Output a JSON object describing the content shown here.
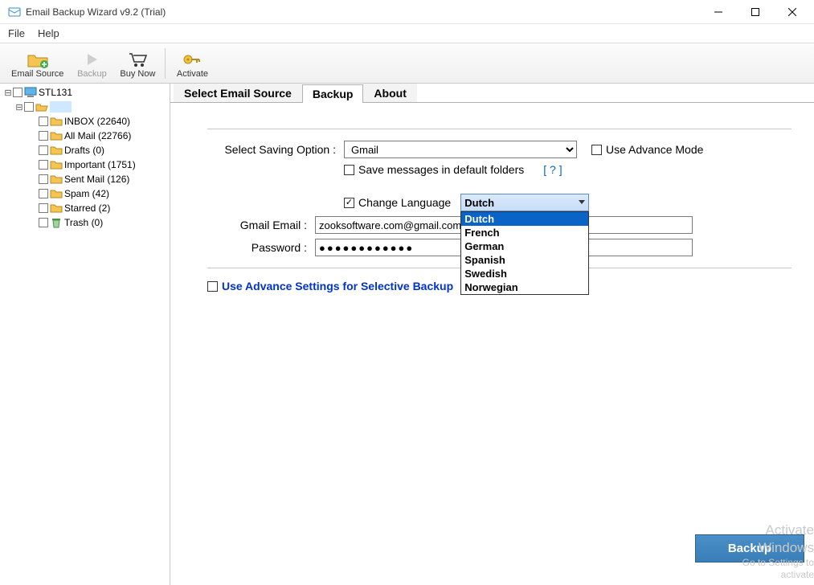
{
  "window": {
    "title": "Email Backup Wizard v9.2 (Trial)"
  },
  "menubar": {
    "file": "File",
    "help": "Help"
  },
  "toolbar": {
    "email_source": "Email Source",
    "backup": "Backup",
    "buy_now": "Buy Now",
    "activate": "Activate"
  },
  "sidebar": {
    "root": "STL131",
    "folders": [
      {
        "name": "INBOX (22640)"
      },
      {
        "name": "All Mail (22766)"
      },
      {
        "name": "Drafts (0)"
      },
      {
        "name": "Important (1751)"
      },
      {
        "name": "Sent Mail (126)"
      },
      {
        "name": "Spam (42)"
      },
      {
        "name": "Starred (2)"
      },
      {
        "name": "Trash (0)"
      }
    ]
  },
  "tabs": {
    "select_source": "Select Email Source",
    "backup": "Backup",
    "about": "About"
  },
  "panel": {
    "saving_option_label": "Select Saving Option :",
    "saving_option_value": "Gmail",
    "advance_mode_label": "Use Advance Mode",
    "save_default_label": "Save messages in default folders",
    "help_link": "[  ?  ]",
    "change_lang_label": "Change Language",
    "lang_selected": "Dutch",
    "lang_options": [
      "Dutch",
      "French",
      "German",
      "Spanish",
      "Swedish",
      "Norwegian"
    ],
    "email_label": "Gmail Email :",
    "email_value": "zooksoftware.com@gmail.com",
    "password_label": "Password :",
    "password_value": "●●●●●●●●●●●●",
    "advance_settings_label": "Use Advance Settings for Selective Backup"
  },
  "footer": {
    "backup_btn": "Backup"
  },
  "watermark": {
    "l1": "Activate Windows",
    "l2": "Go to Settings to activate"
  }
}
